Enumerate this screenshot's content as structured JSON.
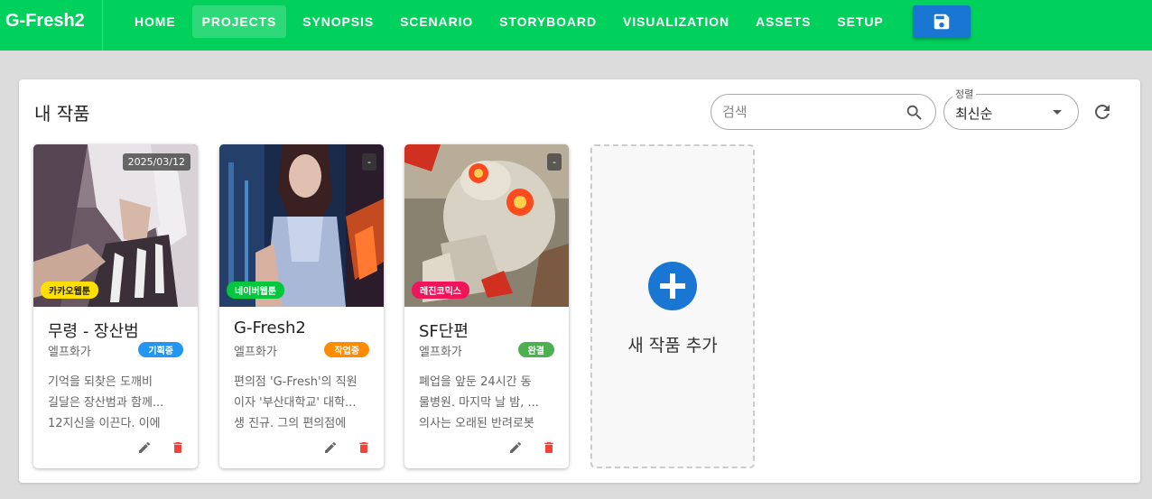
{
  "app": {
    "title": "G-Fresh2"
  },
  "nav": {
    "items": [
      {
        "label": "HOME"
      },
      {
        "label": "PROJECTS"
      },
      {
        "label": "SYNOPSIS"
      },
      {
        "label": "SCENARIO"
      },
      {
        "label": "STORYBOARD"
      },
      {
        "label": "VISUALIZATION"
      },
      {
        "label": "ASSETS"
      },
      {
        "label": "SETUP"
      }
    ],
    "active": "PROJECTS",
    "save_icon": "floppy-disk-icon"
  },
  "panel": {
    "title": "내 작품",
    "search": {
      "placeholder": "검색",
      "value": ""
    },
    "sort": {
      "label": "정렬",
      "value": "최신순"
    }
  },
  "projects": [
    {
      "title": "무령 - 장산범",
      "author": "엘프화가",
      "date": "2025/03/12",
      "platform": "카카오웹툰",
      "platform_color": "#ffe000",
      "status": "기획중",
      "status_color": "#2196f3",
      "desc": [
        "기억을 되찾은 도깨비",
        "길달은 장산범과 함께...",
        "12지신을 이끈다. 이에"
      ]
    },
    {
      "title": "G-Fresh2",
      "author": "엘프화가",
      "date": "-",
      "platform": "네이버웹툰",
      "platform_color": "#00c73c",
      "status": "작업중",
      "status_color": "#ff8c00",
      "desc": [
        "편의점 'G-Fresh'의 직원",
        "이자 '부산대학교' 대학...",
        "생 진규. 그의 편의점에"
      ]
    },
    {
      "title": "SF단편",
      "author": "엘프화가",
      "date": "-",
      "platform": "레진코믹스",
      "platform_color": "#f0145a",
      "status": "완결",
      "status_color": "#4caf50",
      "desc": [
        "폐업을 앞둔 24시간 동",
        "물병원. 마지막 날 밤, ...",
        "의사는 오래된 반려로봇"
      ]
    }
  ],
  "add_card": {
    "label": "새 작품 추가"
  },
  "colors": {
    "topbar": "#00d15c",
    "save_button": "#1976d2",
    "add_icon": "#1976d2",
    "delete_icon": "#f44336"
  }
}
